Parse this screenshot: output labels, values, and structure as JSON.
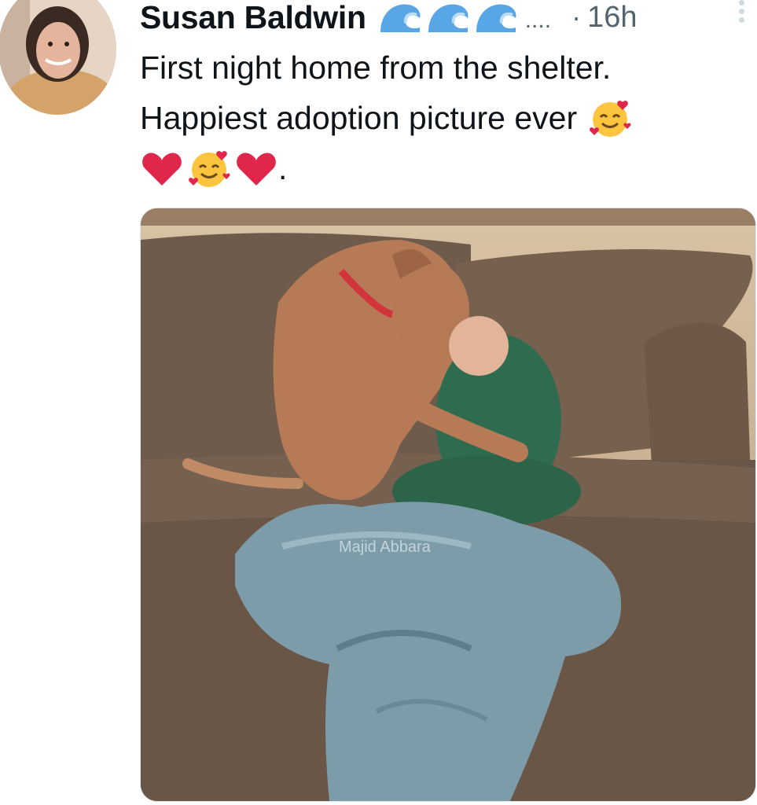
{
  "tweet": {
    "author_name": "Susan Baldwin",
    "name_emoji_icons": [
      "wave-icon",
      "wave-icon",
      "wave-icon"
    ],
    "name_truncation": "....",
    "separator": "·",
    "timestamp": "16h",
    "text_lines": [
      "First night home from the shelter.",
      "Happiest adoption picture ever"
    ],
    "text_end": ".",
    "emoji_icons": [
      "smiling-face-with-hearts-icon",
      "red-heart-icon",
      "smiling-face-with-hearts-icon",
      "red-heart-icon"
    ],
    "media": {
      "watermark": "Majid Abbara"
    }
  },
  "colors": {
    "text_primary": "#0f1419",
    "text_secondary": "#536471",
    "wave_blue": "#58a6e6",
    "heart_red": "#e0264b"
  }
}
